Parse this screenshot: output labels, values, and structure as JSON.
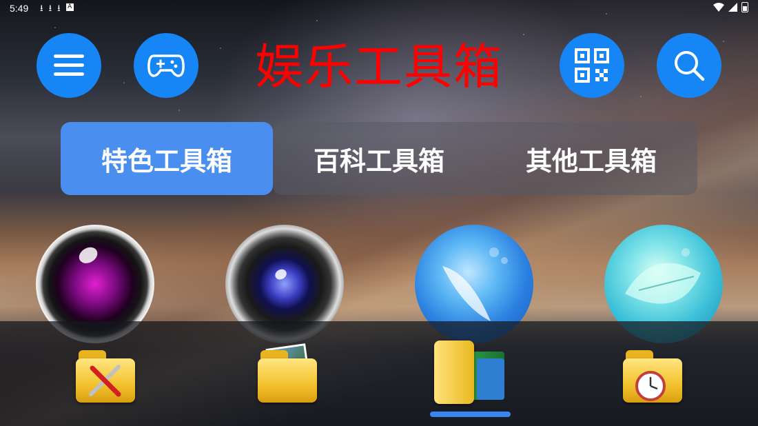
{
  "status_bar": {
    "time": "5:49",
    "notification_icons": [
      "download-icon",
      "download-icon",
      "download-icon",
      "a-icon"
    ],
    "right_icons": [
      "wifi-icon",
      "signal-icon",
      "battery-icon"
    ]
  },
  "header": {
    "title": "娱乐工具箱",
    "title_color": "#ff0000",
    "buttons": [
      "menu-icon",
      "gamepad-icon",
      "qr-code-icon",
      "search-icon"
    ],
    "button_color": "#1685f5"
  },
  "tabs": [
    {
      "label": "特色工具箱",
      "active": true
    },
    {
      "label": "百科工具箱",
      "active": false
    },
    {
      "label": "其他工具箱",
      "active": false
    }
  ],
  "tools": [
    {
      "icon": "camera-lens-purple-icon"
    },
    {
      "icon": "camera-lens-blue-icon"
    },
    {
      "icon": "feather-glass-icon"
    },
    {
      "icon": "leaf-glass-icon"
    }
  ],
  "bottom_nav": [
    {
      "icon": "folder-tools-icon",
      "active": false
    },
    {
      "icon": "folder-photos-icon",
      "active": false
    },
    {
      "icon": "folder-documents-icon",
      "active": true
    },
    {
      "icon": "folder-clock-icon",
      "active": false
    }
  ],
  "colors": {
    "accent": "#4a8ff0",
    "indicator": "#3a86f0"
  }
}
